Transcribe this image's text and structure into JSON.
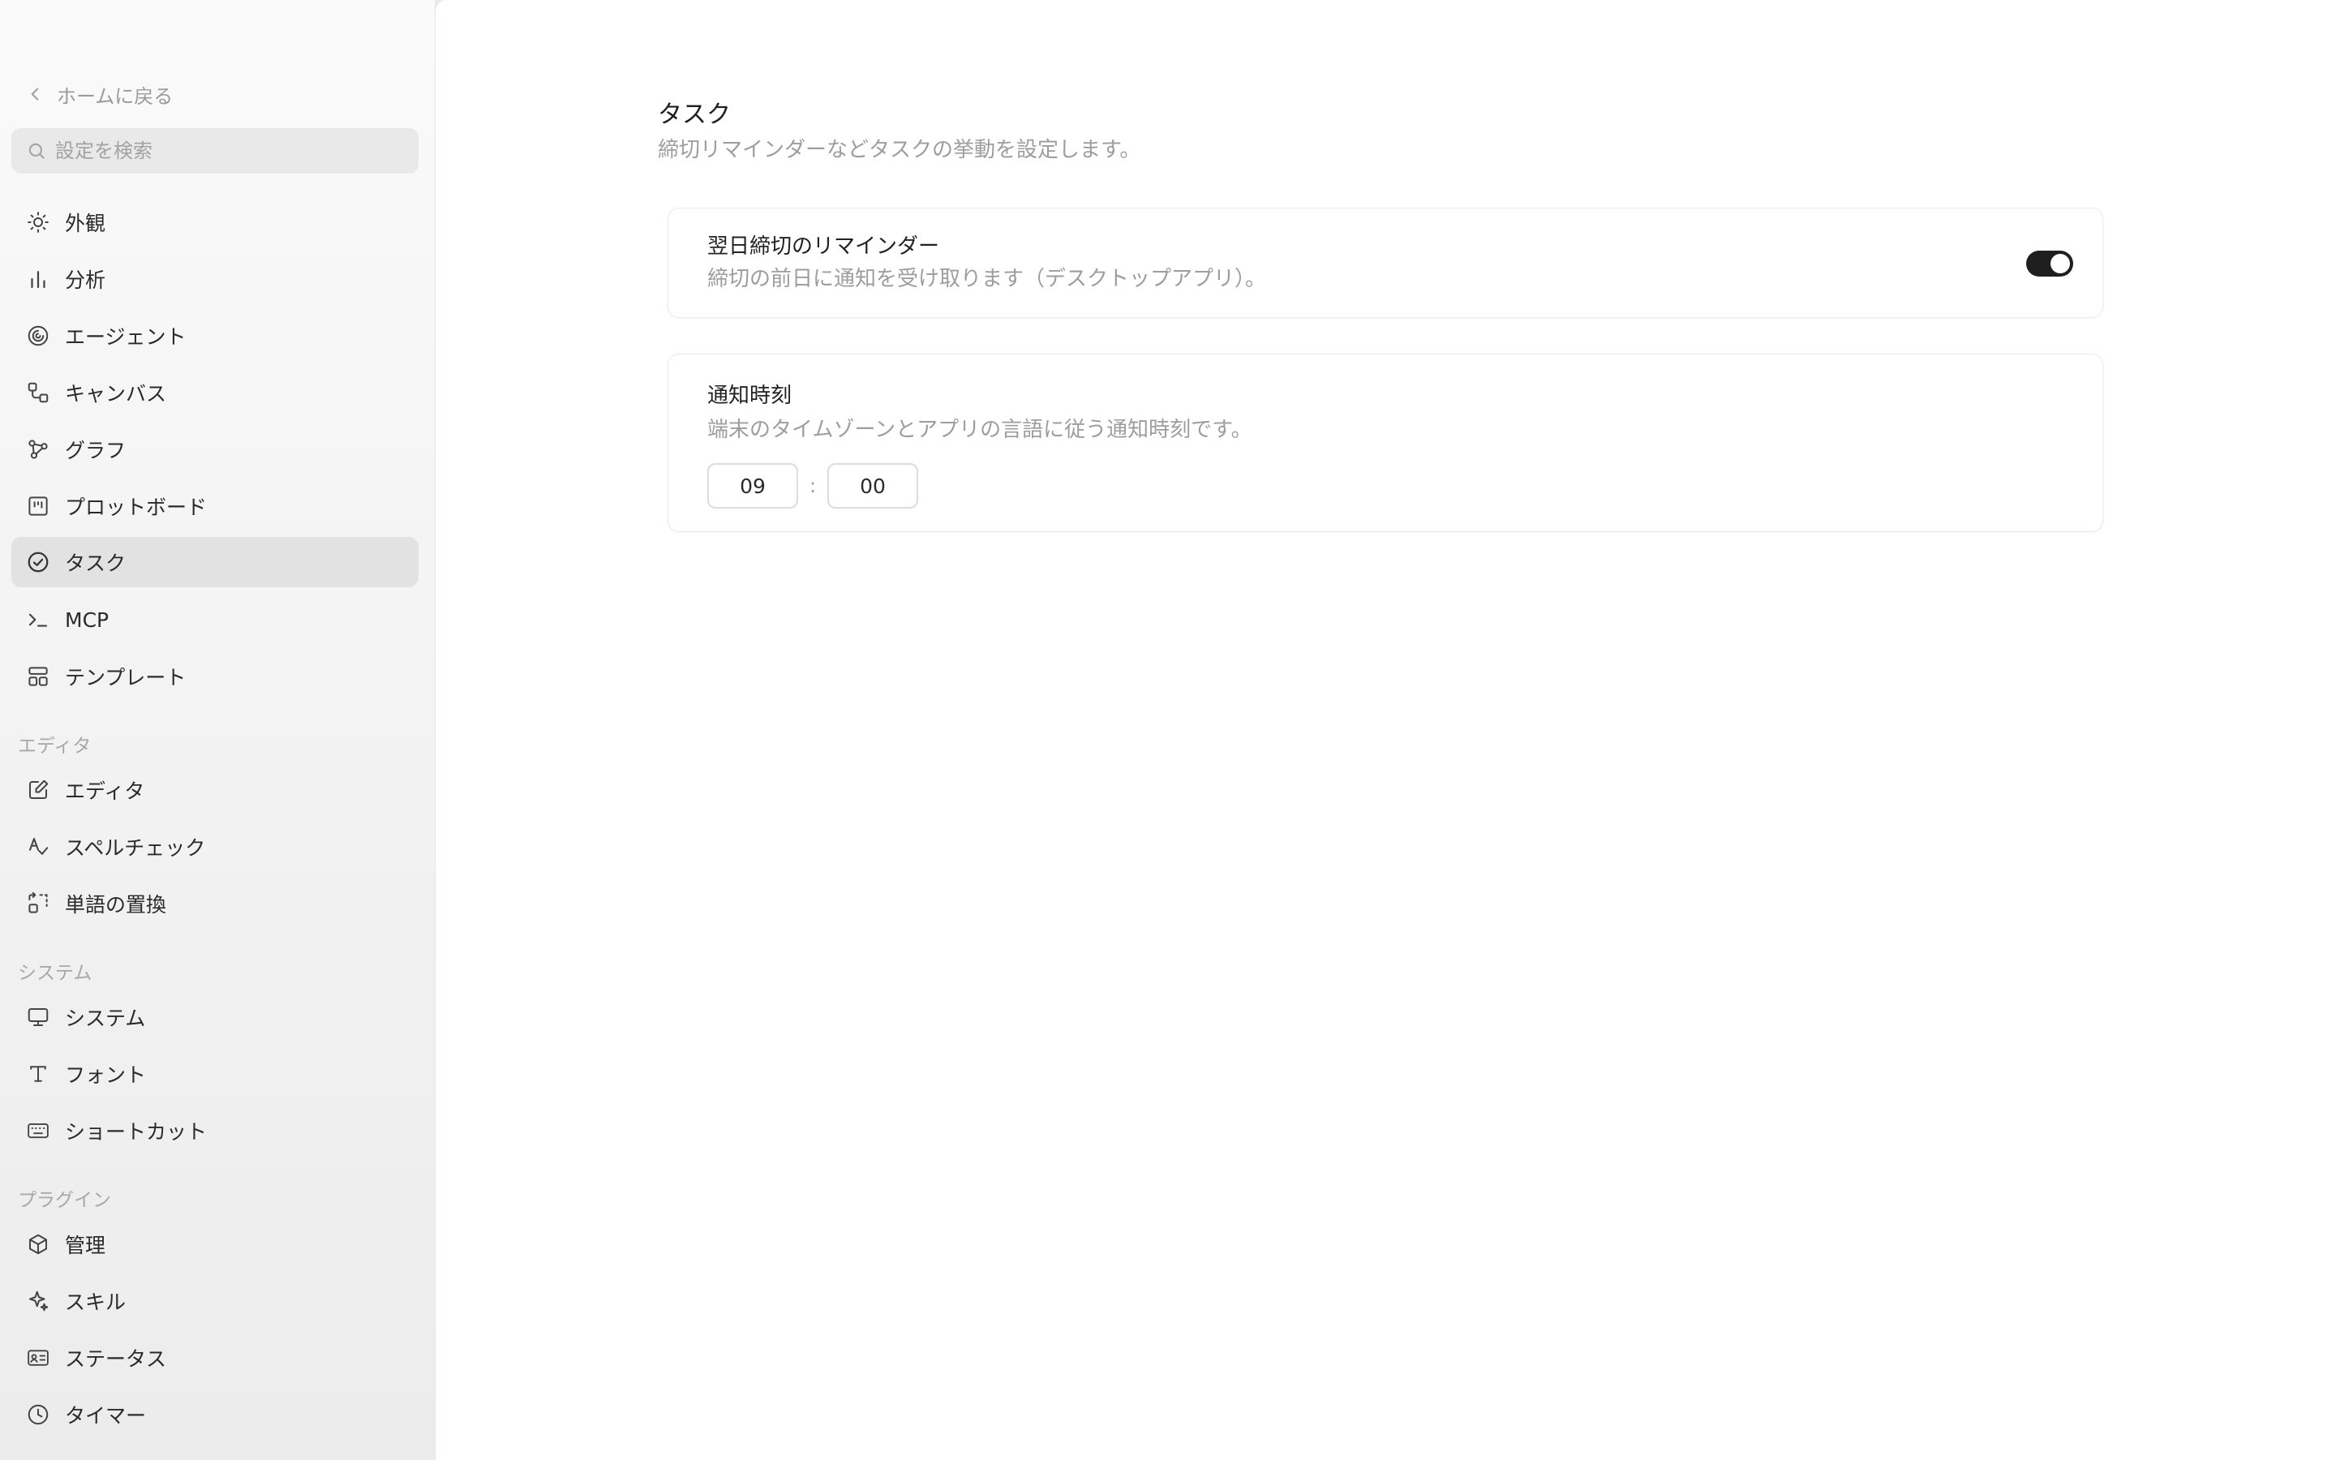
{
  "sidebar": {
    "back_label": "ホームに戻る",
    "search_placeholder": "設定を検索",
    "items": [
      {
        "label": "外観",
        "icon": "sun-icon"
      },
      {
        "label": "分析",
        "icon": "bar-chart-icon"
      },
      {
        "label": "エージェント",
        "icon": "spiral-icon"
      },
      {
        "label": "キャンバス",
        "icon": "canvas-icon"
      },
      {
        "label": "グラフ",
        "icon": "graph-icon"
      },
      {
        "label": "プロットボード",
        "icon": "board-icon"
      },
      {
        "label": "タスク",
        "icon": "check-circle-icon",
        "active": true
      },
      {
        "label": "MCP",
        "icon": "terminal-icon"
      },
      {
        "label": "テンプレート",
        "icon": "layout-icon"
      }
    ],
    "sections": {
      "editor": {
        "label": "エディタ",
        "items": [
          {
            "label": "エディタ",
            "icon": "edit-icon"
          },
          {
            "label": "スペルチェック",
            "icon": "spellcheck-icon"
          },
          {
            "label": "単語の置換",
            "icon": "replace-icon"
          }
        ]
      },
      "system": {
        "label": "システム",
        "items": [
          {
            "label": "システム",
            "icon": "monitor-icon"
          },
          {
            "label": "フォント",
            "icon": "type-icon"
          },
          {
            "label": "ショートカット",
            "icon": "keyboard-icon"
          }
        ]
      },
      "plugin": {
        "label": "プラグイン",
        "items": [
          {
            "label": "管理",
            "icon": "package-icon"
          },
          {
            "label": "スキル",
            "icon": "sparkle-icon"
          },
          {
            "label": "ステータス",
            "icon": "id-card-icon"
          },
          {
            "label": "タイマー",
            "icon": "clock-icon"
          }
        ]
      }
    }
  },
  "main": {
    "title": "タスク",
    "description": "締切リマインダーなどタスクの挙動を設定します。",
    "reminder": {
      "title": "翌日締切のリマインダー",
      "description": "締切の前日に通知を受け取ります（デスクトップアプリ）。",
      "enabled": true
    },
    "notify_time": {
      "title": "通知時刻",
      "description": "端末のタイムゾーンとアプリの言語に従う通知時刻です。",
      "hour": "09",
      "separator": ":",
      "minute": "00"
    }
  }
}
